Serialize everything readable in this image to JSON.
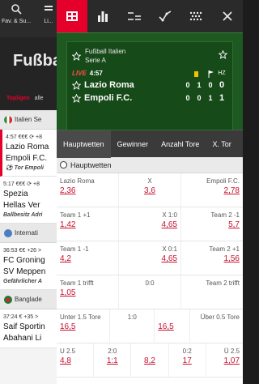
{
  "background": {
    "nav": [
      {
        "icon": "search-icon",
        "label": "Fav. & Su..."
      },
      {
        "icon": "list-icon",
        "label": "Li..."
      }
    ],
    "title": "Fußball",
    "tabs": [
      {
        "label": "Topligen",
        "active": true
      },
      {
        "label": "alle",
        "active": false
      }
    ],
    "groups": [
      {
        "type": "league",
        "flag_color": "#2e8b3e",
        "label": "Italien Se"
      },
      {
        "type": "match",
        "time": "4:57 €€€ ⟳ +8",
        "team1": "Lazio Roma",
        "team2": "Empoli F.C.",
        "info": "⚽ Tor Empoli"
      },
      {
        "type": "match",
        "time": "5:17 €€€ ⟳ +8",
        "team1": "Spezia",
        "team2": "Hellas Ver",
        "info": "Ballbesitz Adri"
      },
      {
        "type": "league",
        "flag_color": "#4a7fc1",
        "label": "Internati"
      },
      {
        "type": "match",
        "time": "36:53 €€ +26 >",
        "team1": "FC Groning",
        "team2": "SV Meppen",
        "info": "Gefährlicher A"
      },
      {
        "type": "league",
        "flag_color": "#1a7a3a",
        "label": "Banglade"
      },
      {
        "type": "match",
        "time": "37:24 € +35 >",
        "team1": "Saif Sportin",
        "team2": "Abahani Li",
        "info": ""
      }
    ]
  },
  "panel": {
    "toolbar": [
      {
        "icon": "scoreboard-icon",
        "active": true
      },
      {
        "icon": "bar-chart-icon",
        "active": false
      },
      {
        "icon": "lineup-icon",
        "active": false
      },
      {
        "icon": "trend-icon",
        "active": false
      },
      {
        "icon": "field-icon",
        "active": false
      },
      {
        "icon": "close-icon",
        "active": false
      }
    ],
    "scoreboard": {
      "league_line1": "Fußball Italien",
      "league_line2": "Serie A",
      "live": "LIVE",
      "clock": "4:57",
      "ht_label": "HZ",
      "teams": [
        {
          "name": "Lazio Roma",
          "scores": [
            "0",
            "1",
            "0",
            "0"
          ]
        },
        {
          "name": "Empoli F.C.",
          "scores": [
            "0",
            "0",
            "1",
            "1"
          ]
        }
      ]
    },
    "market_tabs": [
      {
        "label": "Hauptwetten",
        "active": true
      },
      {
        "label": "Gewinner",
        "active": false
      },
      {
        "label": "Anzahl Tore",
        "active": false
      },
      {
        "label": "X. Tor",
        "active": false
      }
    ],
    "section_title": "Hauptwetten",
    "rows": [
      [
        {
          "align": "left",
          "label": "Lazio Roma",
          "odd": "2,36"
        },
        {
          "align": "mid",
          "label": "X",
          "odd": "3,6"
        },
        {
          "align": "right",
          "label": "Empoli F.C.",
          "odd": "2,78"
        }
      ],
      [
        {
          "align": "left",
          "label": "Team 1 +1",
          "odd": "1,42"
        },
        {
          "align": "mid",
          "label": "X 1:0",
          "odd": "4,65"
        },
        {
          "align": "right",
          "label": "Team 2 -1",
          "odd": "5,7"
        }
      ],
      [
        {
          "align": "left",
          "label": "Team 1 -1",
          "odd": "4,2"
        },
        {
          "align": "mid",
          "label": "X 0:1",
          "odd": "4,65"
        },
        {
          "align": "right",
          "label": "Team 2 +1",
          "odd": "1,56"
        }
      ],
      [
        {
          "align": "left",
          "label": "Team 1 trifft",
          "odd": "1,05"
        },
        {
          "align": "mid",
          "label": "0:0",
          "odd": ""
        },
        {
          "align": "right",
          "label": "Team 2 trifft",
          "odd": ""
        }
      ],
      [
        {
          "align": "left",
          "label": "Unter 1.5 Tore",
          "odd": "16,5"
        },
        {
          "align": "mid",
          "label": "1:0",
          "odd": "16,5"
        },
        {
          "align": "right",
          "label": "Über 0.5 Tore",
          "odd": ""
        }
      ],
      [
        {
          "align": "left",
          "label": "U 2.5",
          "odd": "4,8"
        },
        {
          "align": "mid",
          "label": "2:0",
          "odd": "1:1"
        },
        {
          "align": "mid",
          "label": "",
          "odd": "8,2"
        },
        {
          "align": "mid",
          "label": "0:2",
          "odd": "17"
        },
        {
          "align": "right",
          "label": "Ü 2.5",
          "odd": "1,07"
        }
      ]
    ],
    "accent_color": "#e4002b",
    "odd_color": "#c8102e",
    "scoreboard_green": "#1d5920"
  }
}
